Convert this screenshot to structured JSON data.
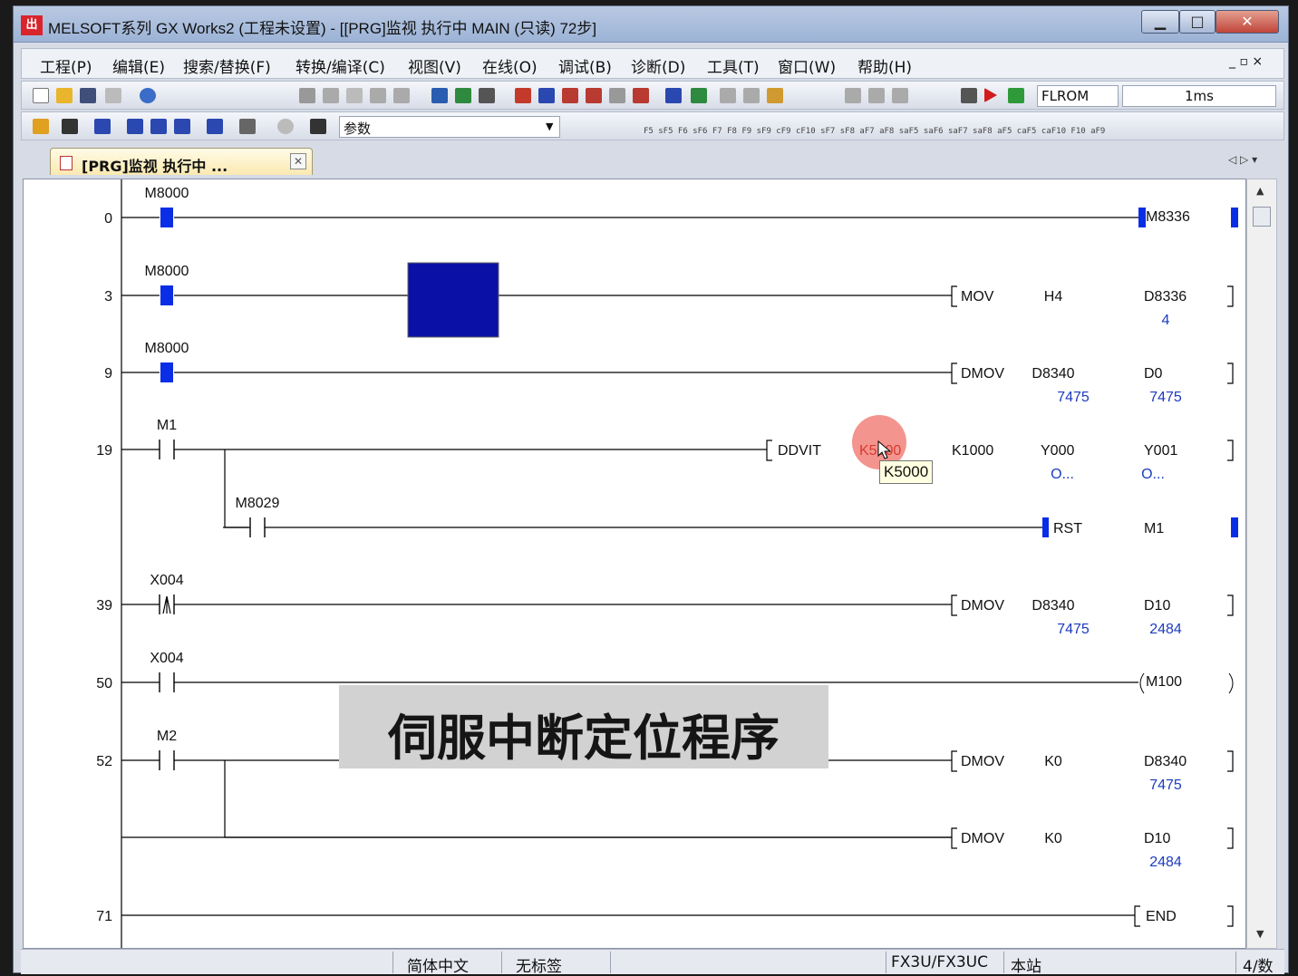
{
  "window": {
    "title": "MELSOFT系列 GX Works2 (工程未设置) - [[PRG]监视 执行中 MAIN (只读) 72步]",
    "app_icon_glyph": "出",
    "minimize_glyph": "▁",
    "maximize_glyph": "□",
    "close_glyph": "✕"
  },
  "menubar": {
    "items": [
      "工程(P)",
      "编辑(E)",
      "搜索/替换(F)",
      "转换/编译(C)",
      "视图(V)",
      "在线(O)",
      "调试(B)",
      "诊断(D)",
      "工具(T)",
      "窗口(W)",
      "帮助(H)"
    ],
    "mdi_controls": "_ ▫ ×"
  },
  "toolbar1": {
    "memory_label": "FLROM",
    "scan_time": "1ms"
  },
  "toolbar2": {
    "param_dropdown": "参数",
    "func_keys": "F5 sF5 F6 sF6 F7 F8  F9 sF9 cF9 cF10 sF7 sF8 aF7 aF8 saF5 saF6 saF7 saF8 aF5 caF5 caF10 F10 aF9"
  },
  "tab": {
    "label": "[PRG]监视 执行中 ...",
    "close_glyph": "✕",
    "nav": "◁ ▷ ▾"
  },
  "ladder": {
    "rungs": [
      {
        "step": "0",
        "contacts": [
          {
            "label": "M8000",
            "type": "no_on"
          }
        ],
        "instruction": "M8336",
        "kind": "coil_on"
      },
      {
        "step": "3",
        "contacts": [
          {
            "label": "M8000",
            "type": "no_on"
          }
        ],
        "instruction": "MOV",
        "op1": "H4",
        "op2": "D8336",
        "op2_val": "4"
      },
      {
        "step": "9",
        "contacts": [
          {
            "label": "M8000",
            "type": "no_on"
          }
        ],
        "instruction": "DMOV",
        "op1": "D8340",
        "op1_val": "7475",
        "op2": "D0",
        "op2_val": "7475"
      },
      {
        "step": "19",
        "contacts": [
          {
            "label": "M1",
            "type": "no"
          }
        ],
        "instruction": "DDVIT",
        "op1": "K5000",
        "op2": "K1000",
        "op3": "Y000",
        "op3_val": "O...",
        "op4": "Y001",
        "op4_val": "O..."
      },
      {
        "step": "",
        "contacts": [
          {
            "label": "M8029",
            "type": "no"
          }
        ],
        "instruction": "RST",
        "op1": "M1"
      },
      {
        "step": "39",
        "contacts": [
          {
            "label": "X004",
            "type": "rising"
          }
        ],
        "instruction": "DMOV",
        "op1": "D8340",
        "op1_val": "7475",
        "op2": "D10",
        "op2_val": "2484"
      },
      {
        "step": "50",
        "contacts": [
          {
            "label": "X004",
            "type": "no"
          }
        ],
        "instruction": "M100",
        "kind": "coil"
      },
      {
        "step": "52",
        "contacts": [
          {
            "label": "M2",
            "type": "no"
          }
        ],
        "instruction": "DMOV",
        "op1": "K0",
        "op2": "D8340",
        "op2_val": "7475"
      },
      {
        "step": "",
        "contacts": [],
        "instruction": "DMOV",
        "op1": "K0",
        "op2": "D10",
        "op2_val": "2484"
      },
      {
        "step": "71",
        "contacts": [],
        "instruction": "END"
      }
    ]
  },
  "tooltip": "K5000",
  "caption": "伺服中断定位程序",
  "statusbar": {
    "language": "简体中文",
    "label_status": "无标签",
    "plc_type": "FX3U/FX3UC",
    "station": "本站",
    "step_info": "4/数"
  },
  "colors": {
    "on_contact": "#0a2ee6",
    "monitor_value": "#1c3bbf",
    "ladder_line": "#000000",
    "caption_bg": "#d2d2d2"
  }
}
